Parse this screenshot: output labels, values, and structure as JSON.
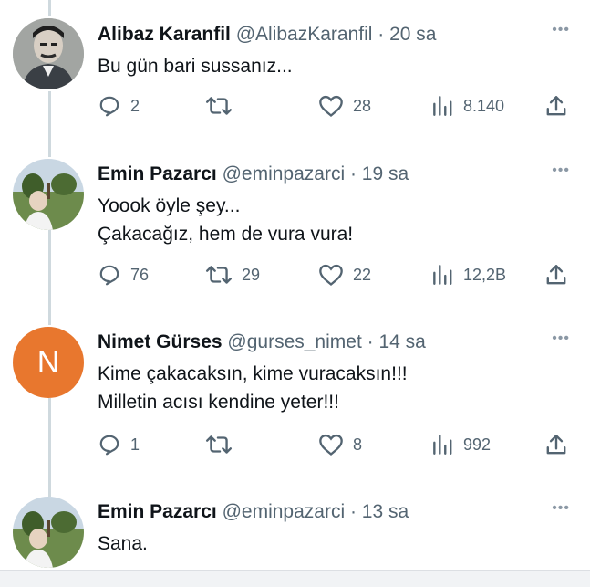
{
  "tweets": [
    {
      "name": "Alibaz Karanfil",
      "handle": "@AlibazKaranfil",
      "time": "· 20 sa",
      "lines": [
        "Bu gün bari sussanız..."
      ],
      "replies": "2",
      "retweets": "",
      "likes": "28",
      "views": "8.140",
      "avatar": "portrait-photo"
    },
    {
      "name": "Emin Pazarcı",
      "handle": "@eminpazarci",
      "time": "· 19 sa",
      "lines": [
        "Yoook öyle şey...",
        "Çakacağız, hem de vura vura!"
      ],
      "replies": "76",
      "retweets": "29",
      "likes": "22",
      "views": "12,2B",
      "avatar": "landscape-photo"
    },
    {
      "name": "Nimet Gürses",
      "handle": "@gurses_nimet",
      "time": "· 14 sa",
      "lines": [
        "Kime çakacaksın, kime vuracaksın!!!",
        "Milletin acısı kendine yeter!!!"
      ],
      "replies": "1",
      "retweets": "",
      "likes": "8",
      "views": "992",
      "avatar": "N",
      "avatar_color": "#e8772e"
    },
    {
      "name": "Emin Pazarcı",
      "handle": "@eminpazarci",
      "time": "· 13 sa",
      "lines": [
        "Sana."
      ],
      "avatar": "landscape-photo"
    }
  ],
  "more_label": "•••",
  "icons": {
    "reply": "reply-icon",
    "retweet": "retweet-icon",
    "like": "heart-icon",
    "views": "views-icon",
    "share": "share-icon"
  }
}
